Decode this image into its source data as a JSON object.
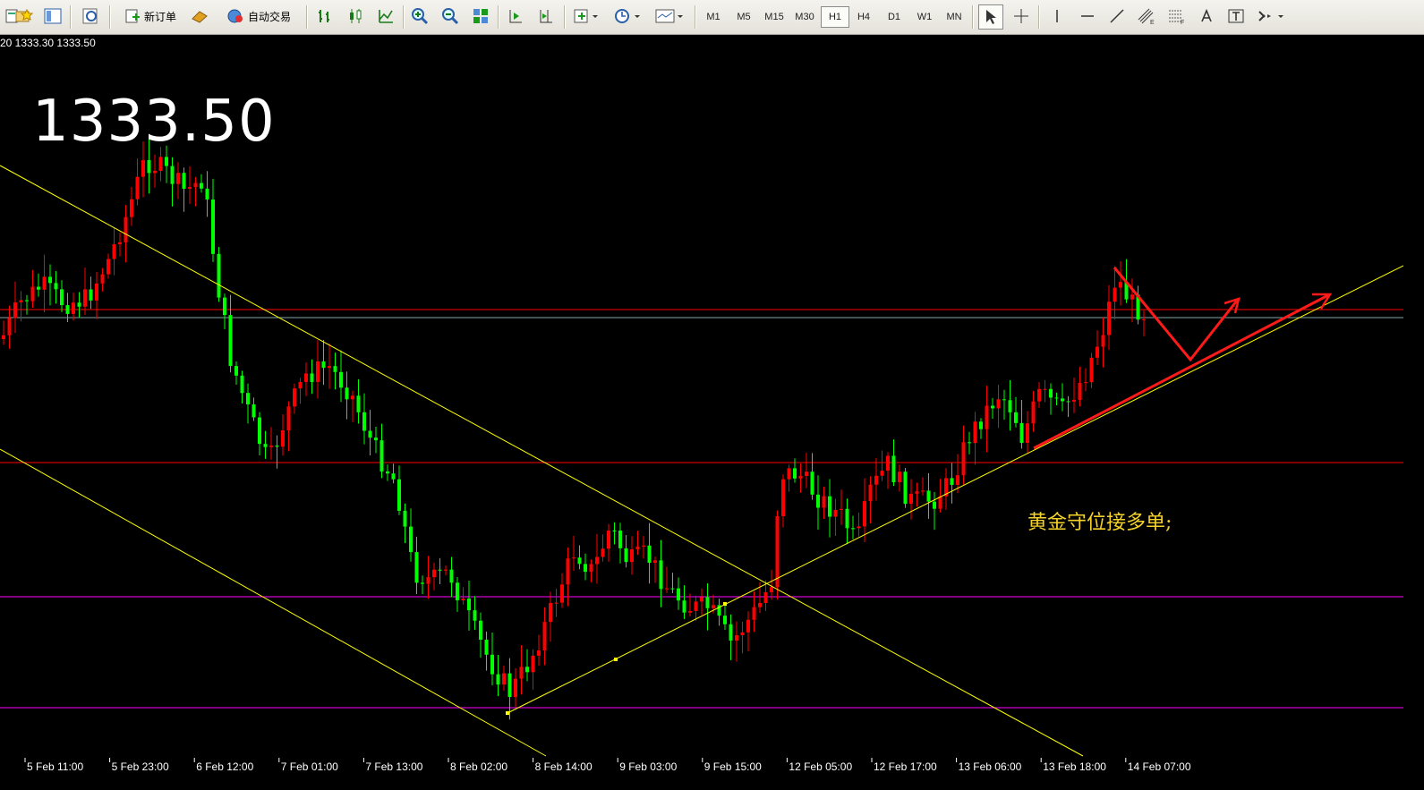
{
  "toolbar": {
    "new_order_label": "新订单",
    "auto_trade_label": "自动交易",
    "timeframes": [
      "M1",
      "M5",
      "M15",
      "M30",
      "H1",
      "H4",
      "D1",
      "W1",
      "MN"
    ],
    "active_timeframe": "H1"
  },
  "chart": {
    "info_line": "20 1333.30 1333.50",
    "big_price": "1333.50",
    "annotation": "黄金守位接多单;",
    "background": "#000000",
    "bull_color": "#ff0000",
    "bear_color": "#00ff00",
    "trendline_color": "#ffff00",
    "time_labels": [
      "5 Feb 11:00",
      "5 Feb 23:00",
      "6 Feb 12:00",
      "7 Feb 01:00",
      "7 Feb 13:00",
      "8 Feb 02:00",
      "8 Feb 14:00",
      "9 Feb 03:00",
      "9 Feb 15:00",
      "12 Feb 05:00",
      "12 Feb 17:00",
      "13 Feb 06:00",
      "13 Feb 18:00",
      "14 Feb 07:00"
    ]
  },
  "chart_data": {
    "type": "candlestick",
    "symbol_price": "1333.50",
    "timeframe": "H1",
    "x_tick_labels": [
      "5 Feb 11:00",
      "5 Feb 23:00",
      "6 Feb 12:00",
      "7 Feb 01:00",
      "7 Feb 13:00",
      "8 Feb 02:00",
      "8 Feb 14:00",
      "9 Feb 03:00",
      "9 Feb 15:00",
      "12 Feb 05:00",
      "12 Feb 17:00",
      "13 Feb 06:00",
      "13 Feb 18:00",
      "14 Feb 07:00"
    ],
    "grid": false,
    "horizontal_lines": [
      {
        "color": "#ff0000",
        "kind": "resistance"
      },
      {
        "color": "#ff0000",
        "kind": "support"
      },
      {
        "color": "#ff00ff",
        "kind": "support"
      },
      {
        "color": "#ff00ff",
        "kind": "support"
      }
    ],
    "annotations": [
      "黄金守位接多单;"
    ]
  }
}
